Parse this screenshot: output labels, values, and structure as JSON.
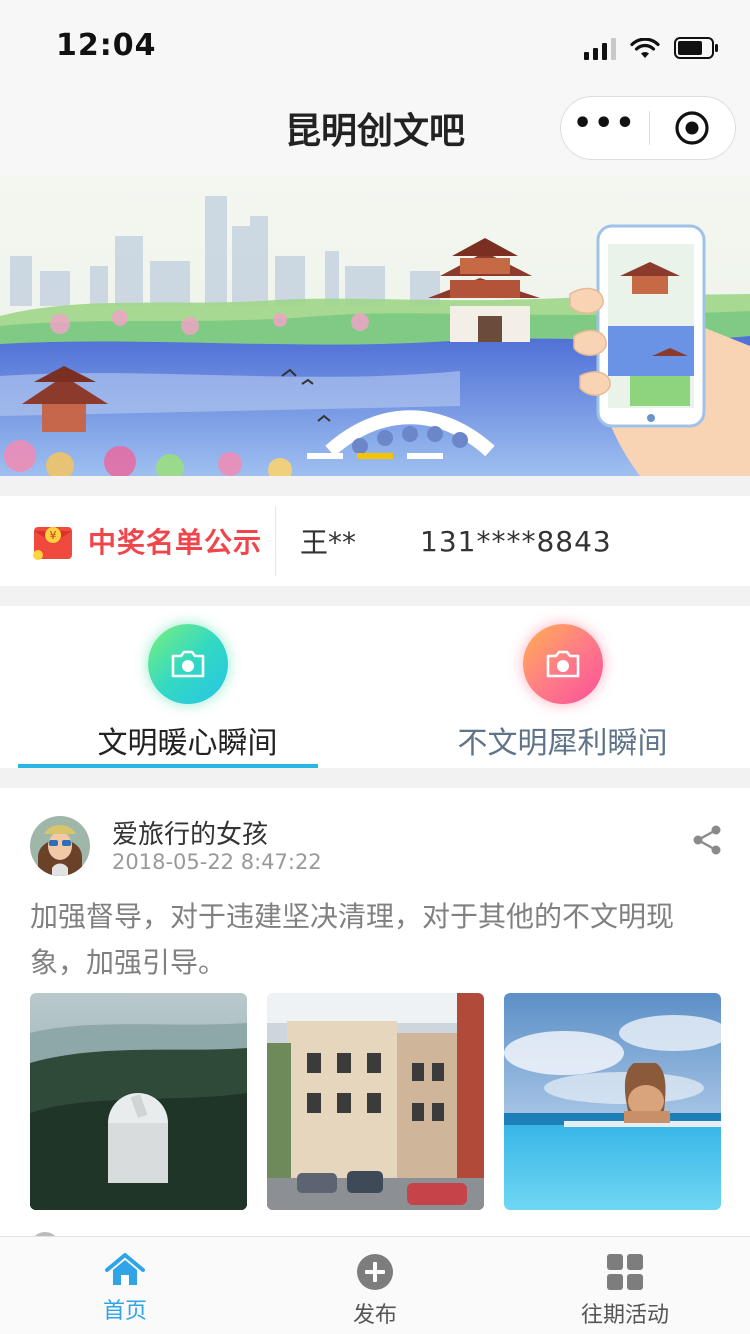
{
  "status_bar": {
    "time": "12:04"
  },
  "nav": {
    "title": "昆明创文吧"
  },
  "banner": {
    "slide_count": 3,
    "active_slide": 2
  },
  "winners": {
    "label": "中奖名单公示",
    "name": "王**",
    "phone": "131****8843"
  },
  "category_tabs": [
    {
      "label": "文明暖心瞬间",
      "active": true,
      "icon": "camera-icon"
    },
    {
      "label": "不文明犀利瞬间",
      "active": false,
      "icon": "camera-icon"
    }
  ],
  "post": {
    "author": "爱旅行的女孩",
    "time": "2018-05-22 8:47:22",
    "text": "加强督导，对于违建坚决清理，对于其他的不文明现象，加强引导。",
    "photos": [
      "observatory-forest-photo",
      "old-town-street-photo",
      "infinity-pool-photo"
    ]
  },
  "tab_bar": {
    "items": [
      {
        "label": "首页",
        "icon": "home-icon",
        "active": true
      },
      {
        "label": "发布",
        "icon": "plus-circle-icon",
        "active": false
      },
      {
        "label": "往期活动",
        "icon": "grid-icon",
        "active": false
      }
    ]
  },
  "colors": {
    "accent": "#2fa4e7",
    "tab_underline": "#28b6e3",
    "winner_red": "#f0454b",
    "banner_dot_active": "#f5c400"
  }
}
